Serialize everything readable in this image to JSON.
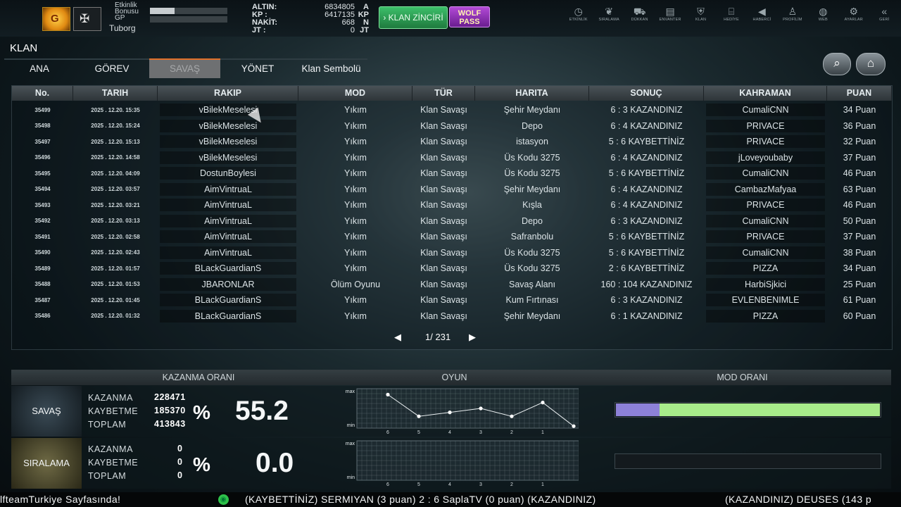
{
  "top": {
    "bonus_label_1": "Etkinlik",
    "bonus_label_2": "Bonusu",
    "bonus_label_3": "GP",
    "bonus_progress": 0.32,
    "clan": "Tuborg",
    "currencies": [
      {
        "label": "ALTIN:",
        "value": "6834805",
        "unit": "A"
      },
      {
        "label": "KP   :",
        "value": "6417135",
        "unit": "KP"
      },
      {
        "label": "NAKİT:",
        "value": "668",
        "unit": "N"
      },
      {
        "label": "JT   :",
        "value": "0",
        "unit": "JT"
      }
    ],
    "klan_zinciri": "› KLAN ZİNCİRİ",
    "wolf_pass_1": "WOLF",
    "wolf_pass_2": "PASS",
    "nav": [
      {
        "icon": "clock-icon",
        "glyph": "◷",
        "label": "ETKİNLİK"
      },
      {
        "icon": "laurel-icon",
        "glyph": "❦",
        "label": "SIRALAMA"
      },
      {
        "icon": "cart-icon",
        "glyph": "⛟",
        "label": "DÜKKAN"
      },
      {
        "icon": "inventory-icon",
        "glyph": "▤",
        "label": "ENVANTER"
      },
      {
        "icon": "clan-shield-icon",
        "glyph": "⛨",
        "label": "KLAN"
      },
      {
        "icon": "gift-icon",
        "glyph": "⌸",
        "label": "HEDİYE"
      },
      {
        "icon": "megaphone-icon",
        "glyph": "◀",
        "label": "HABERCİ"
      },
      {
        "icon": "profile-icon",
        "glyph": "♙",
        "label": "PROFİLİM"
      },
      {
        "icon": "globe-icon",
        "glyph": "◍",
        "label": "WEB"
      },
      {
        "icon": "gear-icon",
        "glyph": "⚙",
        "label": "AYARLAR"
      },
      {
        "icon": "back-icon",
        "glyph": "«",
        "label": "GERİ"
      }
    ]
  },
  "section_title": "KLAN",
  "tabs": [
    "ANA",
    "GÖREV",
    "SAVAŞ",
    "YÖNET",
    "Klan Sembolü"
  ],
  "active_tab": "SAVAŞ",
  "table": {
    "headers": [
      "No.",
      "TARIH",
      "RAKIP",
      "MOD",
      "TÜR",
      "HARITA",
      "SONUÇ",
      "KAHRAMAN",
      "PUAN"
    ],
    "rows": [
      [
        "35499",
        "2025 . 12.20. 15:35",
        "vBilekMeselesi",
        "Yıkım",
        "Klan Savaşı",
        "Şehir Meydanı",
        "6 : 3 KAZANDINIZ",
        "CumaliCNN",
        "34 Puan"
      ],
      [
        "35498",
        "2025 . 12.20. 15:24",
        "vBilekMeselesi",
        "Yıkım",
        "Klan Savaşı",
        "Depo",
        "6 : 4 KAZANDINIZ",
        "PRIVACE",
        "36 Puan"
      ],
      [
        "35497",
        "2025 . 12.20. 15:13",
        "vBilekMeselesi",
        "Yıkım",
        "Klan Savaşı",
        "istasyon",
        "5 : 6 KAYBETTİNİZ",
        "PRIVACE",
        "32 Puan"
      ],
      [
        "35496",
        "2025 . 12.20. 14:58",
        "vBilekMeselesi",
        "Yıkım",
        "Klan Savaşı",
        "Üs Kodu 3275",
        "6 : 4 KAZANDINIZ",
        "jLoveyoubaby",
        "37 Puan"
      ],
      [
        "35495",
        "2025 . 12.20. 04:09",
        "DostunBoylesi",
        "Yıkım",
        "Klan Savaşı",
        "Üs Kodu 3275",
        "5 : 6 KAYBETTİNİZ",
        "CumaliCNN",
        "46 Puan"
      ],
      [
        "35494",
        "2025 . 12.20. 03:57",
        "AimVintruaL",
        "Yıkım",
        "Klan Savaşı",
        "Şehir Meydanı",
        "6 : 4 KAZANDINIZ",
        "CambazMafyaa",
        "63 Puan"
      ],
      [
        "35493",
        "2025 . 12.20. 03:21",
        "AimVintruaL",
        "Yıkım",
        "Klan Savaşı",
        "Kışla",
        "6 : 4 KAZANDINIZ",
        "PRIVACE",
        "46 Puan"
      ],
      [
        "35492",
        "2025 . 12.20. 03:13",
        "AimVintruaL",
        "Yıkım",
        "Klan Savaşı",
        "Depo",
        "6 : 3 KAZANDINIZ",
        "CumaliCNN",
        "50 Puan"
      ],
      [
        "35491",
        "2025 . 12.20. 02:58",
        "AimVintruaL",
        "Yıkım",
        "Klan Savaşı",
        "Safranbolu",
        "5 : 6 KAYBETTİNİZ",
        "PRIVACE",
        "37 Puan"
      ],
      [
        "35490",
        "2025 . 12.20. 02:43",
        "AimVintruaL",
        "Yıkım",
        "Klan Savaşı",
        "Üs Kodu 3275",
        "5 : 6 KAYBETTİNİZ",
        "CumaliCNN",
        "38 Puan"
      ],
      [
        "35489",
        "2025 . 12.20. 01:57",
        "BLackGuardianS",
        "Yıkım",
        "Klan Savaşı",
        "Üs Kodu 3275",
        "2 : 6 KAYBETTİNİZ",
        "PIZZA",
        "34 Puan"
      ],
      [
        "35488",
        "2025 . 12.20. 01:53",
        "JBARONLAR",
        "Ölüm Oyunu",
        "Klan Savaşı",
        "Savaş Alanı",
        "160 : 104 KAZANDINIZ",
        "HarbiSjkici",
        "25 Puan"
      ],
      [
        "35487",
        "2025 . 12.20. 01:45",
        "BLackGuardianS",
        "Yıkım",
        "Klan Savaşı",
        "Kum Fırtınası",
        "6 : 3 KAZANDINIZ",
        "EVLENBENIMLE",
        "61 Puan"
      ],
      [
        "35486",
        "2025 . 12.20. 01:32",
        "BLackGuardianS",
        "Yıkım",
        "Klan Savaşı",
        "Şehir Meydanı",
        "6 : 1 KAZANDINIZ",
        "PIZZA",
        "60 Puan"
      ]
    ]
  },
  "pager": {
    "text": "1/ 231",
    "prev": "◀",
    "next": "▶"
  },
  "stats": {
    "headers": {
      "kazanma": "KAZANMA ORANI",
      "oyun": "OYUN",
      "mod": "MOD ORANI"
    },
    "savas": {
      "label": "SAVAŞ",
      "kazanma_label": "KAZANMA",
      "kazanma": "228471",
      "kaybetme_label": "KAYBETME",
      "kaybetme": "185370",
      "toplam_label": "TOPLAM",
      "toplam": "413843",
      "percent_sign": "%",
      "rate": "55.2",
      "mod_ratio": 0.165
    },
    "siralama": {
      "label": "SIRALAMA",
      "kazanma_label": "KAZANMA",
      "kazanma": "0",
      "kaybetme_label": "KAYBETME",
      "kaybetme": "0",
      "toplam_label": "TOPLAM",
      "toplam": "0",
      "percent_sign": "%",
      "rate": "0.0",
      "mod_ratio": 0
    },
    "chart_ticks": [
      "6",
      "5",
      "4",
      "3",
      "2",
      "1"
    ],
    "chart_max": "max",
    "chart_min": "min"
  },
  "chart_data": [
    {
      "type": "line",
      "x": [
        "6",
        "5",
        "4",
        "3",
        "2",
        "1",
        ""
      ],
      "values": [
        0.85,
        0.3,
        0.4,
        0.5,
        0.3,
        0.65,
        0.05
      ],
      "ylabel_top": "max",
      "ylabel_bottom": "min"
    },
    {
      "type": "line",
      "x": [
        "6",
        "5",
        "4",
        "3",
        "2",
        "1"
      ],
      "values": [],
      "ylabel_top": "max",
      "ylabel_bottom": "min"
    }
  ],
  "ticker": {
    "left": "lfteamTurkiye Sayfasında!",
    "middle": "(KAYBETTİNİZ) SERMIYAN (3 puan) 2 : 6 SaplaTV (0 puan) (KAZANDINIZ)",
    "right": "(KAZANDINIZ) DEUSES (143 p"
  }
}
